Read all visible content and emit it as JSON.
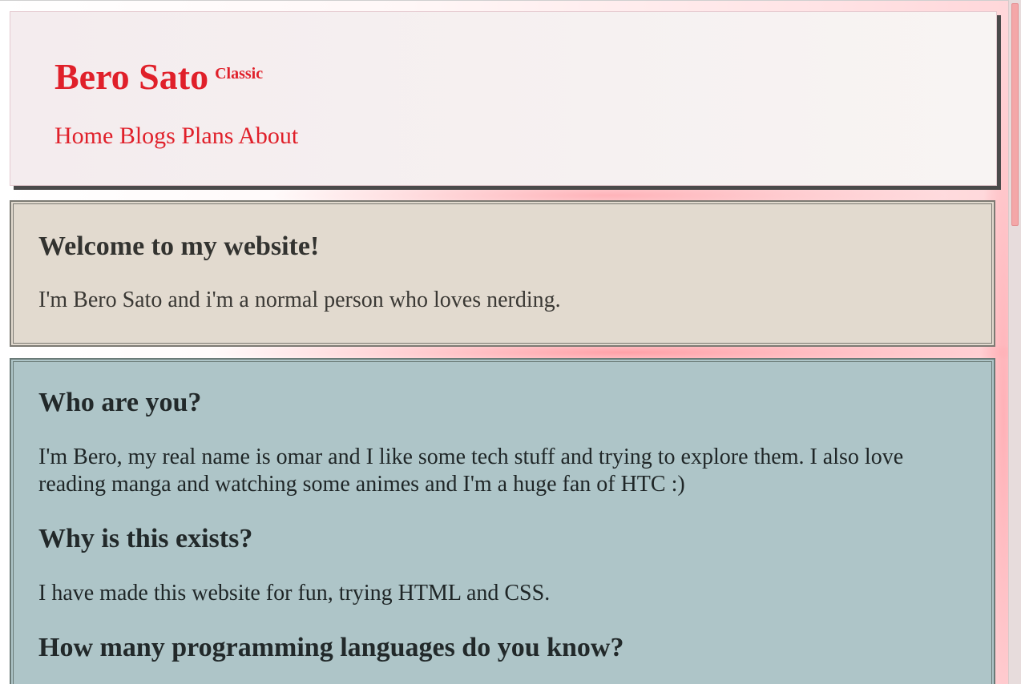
{
  "header": {
    "title": "Bero Sato",
    "badge": "Classic",
    "nav": [
      {
        "label": "Home"
      },
      {
        "label": "Blogs"
      },
      {
        "label": "Plans"
      },
      {
        "label": "About"
      }
    ]
  },
  "welcome": {
    "heading": "Welcome to my website!",
    "text": "I'm Bero Sato and i'm a normal person who loves nerding."
  },
  "about": {
    "q1": {
      "heading": "Who are you?",
      "text": "I'm Bero, my real name is omar and I like some tech stuff and trying to explore them. I also love reading manga and watching some animes and I'm a huge fan of HTC :)"
    },
    "q2": {
      "heading": "Why is this exists?",
      "text": "I have made this website for fun, trying HTML and CSS."
    },
    "q3": {
      "heading": "How many programming languages do you know?"
    }
  },
  "colors": {
    "accent": "#e0202a",
    "welcome_bg": "#e2dacf",
    "about_bg": "#aec5c8",
    "scroll_thumb": "#f4a7a8"
  }
}
